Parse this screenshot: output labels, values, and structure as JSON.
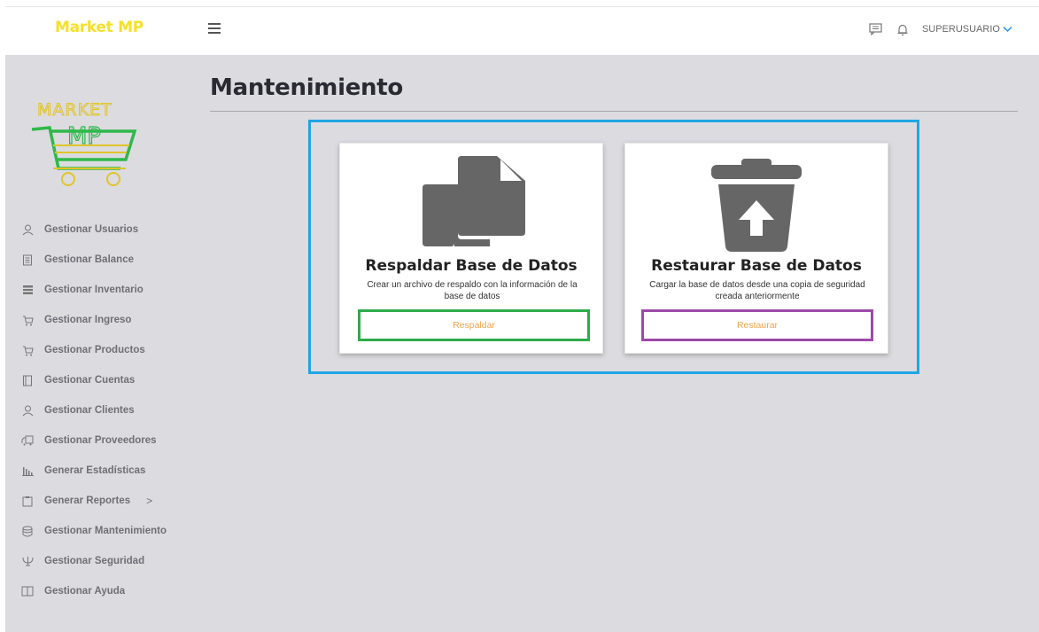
{
  "app": {
    "brand": "Market MP",
    "logo_top_text": "MARKET",
    "logo_cart_text": "MP",
    "user_label": "SUPERUSUARIO"
  },
  "header": {
    "icons": [
      "menu-icon",
      "chat-icon",
      "bell-icon",
      "chevron-down-icon"
    ]
  },
  "sidebar": {
    "items": [
      {
        "label": "Gestionar Usuarios",
        "icon": "user-icon"
      },
      {
        "label": "Gestionar Balance",
        "icon": "ledger-icon"
      },
      {
        "label": "Gestionar Inventario",
        "icon": "list-icon"
      },
      {
        "label": "Gestionar Ingreso",
        "icon": "cart-icon"
      },
      {
        "label": "Gestionar Productos",
        "icon": "cart-icon"
      },
      {
        "label": "Gestionar Cuentas",
        "icon": "book-icon"
      },
      {
        "label": "Gestionar Clientes",
        "icon": "user-icon"
      },
      {
        "label": "Gestionar Proveedores",
        "icon": "truck-icon"
      },
      {
        "label": "Generar Estadísticas",
        "icon": "bar-chart-icon"
      },
      {
        "label": "Generar Reportes",
        "icon": "clipboard-icon",
        "chevron": ">"
      },
      {
        "label": "Gestionar Mantenimiento",
        "icon": "database-icon"
      },
      {
        "label": "Gestionar Seguridad",
        "icon": "shield-icon"
      },
      {
        "label": "Gestionar Ayuda",
        "icon": "open-book-icon"
      }
    ]
  },
  "main": {
    "title": "Mantenimiento",
    "cards": [
      {
        "title": "Respaldar Base de Datos",
        "description": "Crear un archivo de respaldo con la información de la base de datos",
        "button": "Respaldar",
        "icon": "copy-files-icon"
      },
      {
        "title": "Restaurar Base de Datos",
        "description": "Cargar la base de datos desde una copia de seguridad creada anteriormente",
        "button": "Restaurar",
        "icon": "trash-restore-icon"
      }
    ]
  },
  "colors": {
    "brand": "#f5e02a",
    "frame_outline": "#1fa6e4",
    "backup_outline": "#2eab4a",
    "restore_outline": "#9c4aa8",
    "button_text": "#f2a54a",
    "content_bg": "#dcdbe0"
  }
}
